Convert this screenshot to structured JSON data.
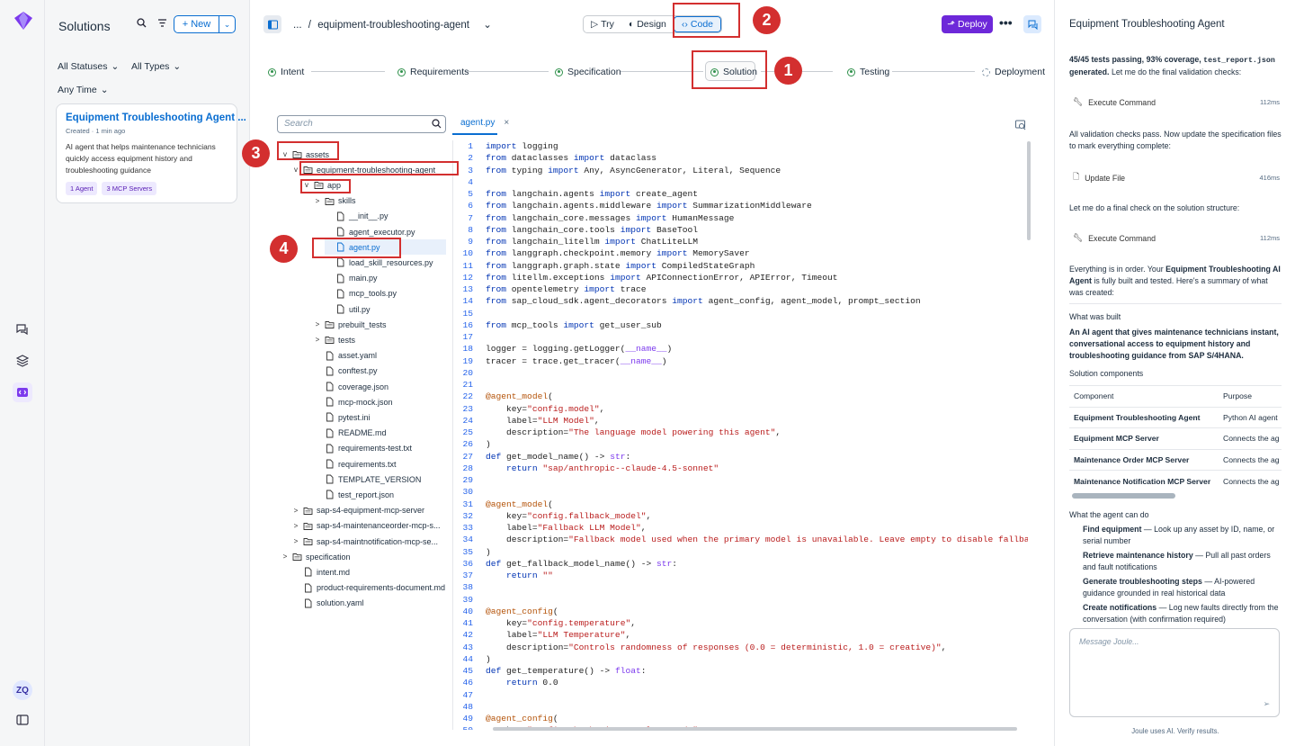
{
  "rail": {
    "user_initials": "ZQ"
  },
  "solutions": {
    "title": "Solutions",
    "new_label": "New",
    "filters": {
      "status": "All Statuses",
      "type": "All Types",
      "time": "Any Time"
    },
    "card": {
      "title": "Equipment Troubleshooting Agent",
      "more": "...",
      "created": "Created · 1 min ago",
      "description": "AI agent that helps maintenance technicians quickly access equipment history and troubleshooting guidance",
      "tags": [
        "1 Agent",
        "3 MCP Servers"
      ]
    }
  },
  "topbar": {
    "breadcrumb_ellipsis": "...",
    "breadcrumb_sep": "/",
    "project": "equipment-troubleshooting-agent",
    "modes": [
      "Try",
      "Design",
      "Code"
    ],
    "deploy_label": "Deploy",
    "more": "•••"
  },
  "steps": [
    "Intent",
    "Requirements",
    "Specification",
    "Solution",
    "Testing",
    "Deployment"
  ],
  "tree": {
    "search_placeholder": "Search",
    "items": [
      {
        "label": "assets",
        "caret": "v",
        "icon": "folder"
      },
      {
        "label": "equipment-troubleshooting-agent",
        "caret": "v",
        "icon": "folder"
      },
      {
        "label": "app",
        "caret": "v",
        "icon": "folder"
      },
      {
        "label": "skills",
        "caret": ">",
        "icon": "folder"
      },
      {
        "label": "__init__.py",
        "caret": "",
        "icon": "file"
      },
      {
        "label": "agent_executor.py",
        "caret": "",
        "icon": "file"
      },
      {
        "label": "agent.py",
        "caret": "",
        "icon": "file",
        "selected": true
      },
      {
        "label": "load_skill_resources.py",
        "caret": "",
        "icon": "file"
      },
      {
        "label": "main.py",
        "caret": "",
        "icon": "file"
      },
      {
        "label": "mcp_tools.py",
        "caret": "",
        "icon": "file"
      },
      {
        "label": "util.py",
        "caret": "",
        "icon": "file"
      },
      {
        "label": "prebuilt_tests",
        "caret": ">",
        "icon": "folder"
      },
      {
        "label": "tests",
        "caret": ">",
        "icon": "folder"
      },
      {
        "label": "asset.yaml",
        "caret": "",
        "icon": "file"
      },
      {
        "label": "conftest.py",
        "caret": "",
        "icon": "file"
      },
      {
        "label": "coverage.json",
        "caret": "",
        "icon": "file"
      },
      {
        "label": "mcp-mock.json",
        "caret": "",
        "icon": "file"
      },
      {
        "label": "pytest.ini",
        "caret": "",
        "icon": "file"
      },
      {
        "label": "README.md",
        "caret": "",
        "icon": "file"
      },
      {
        "label": "requirements-test.txt",
        "caret": "",
        "icon": "file"
      },
      {
        "label": "requirements.txt",
        "caret": "",
        "icon": "file"
      },
      {
        "label": "TEMPLATE_VERSION",
        "caret": "",
        "icon": "file"
      },
      {
        "label": "test_report.json",
        "caret": "",
        "icon": "file"
      },
      {
        "label": "sap-s4-equipment-mcp-server",
        "caret": ">",
        "icon": "folder"
      },
      {
        "label": "sap-s4-maintenanceorder-mcp-s...",
        "caret": ">",
        "icon": "folder"
      },
      {
        "label": "sap-s4-maintnotification-mcp-se...",
        "caret": ">",
        "icon": "folder"
      },
      {
        "label": "specification",
        "caret": ">",
        "icon": "folder"
      },
      {
        "label": "intent.md",
        "caret": "",
        "icon": "file"
      },
      {
        "label": "product-requirements-document.md",
        "caret": "",
        "icon": "file"
      },
      {
        "label": "solution.yaml",
        "caret": "",
        "icon": "file"
      }
    ]
  },
  "editor": {
    "tab": "agent.py",
    "tab_close": "×",
    "lines": [
      "import logging",
      "from dataclasses import dataclass",
      "from typing import Any, AsyncGenerator, Literal, Sequence",
      "",
      "from langchain.agents import create_agent",
      "from langchain.agents.middleware import SummarizationMiddleware",
      "from langchain_core.messages import HumanMessage",
      "from langchain_core.tools import BaseTool",
      "from langchain_litellm import ChatLiteLLM",
      "from langgraph.checkpoint.memory import MemorySaver",
      "from langgraph.graph.state import CompiledStateGraph",
      "from litellm.exceptions import APIConnectionError, APIError, Timeout",
      "from opentelemetry import trace",
      "from sap_cloud_sdk.agent_decorators import agent_config, agent_model, prompt_section",
      "",
      "from mcp_tools import get_user_sub",
      "",
      "logger = logging.getLogger(__name__)",
      "tracer = trace.get_tracer(__name__)",
      "",
      "",
      "@agent_model(",
      "    key=\"config.model\",",
      "    label=\"LLM Model\",",
      "    description=\"The language model powering this agent\",",
      ")",
      "def get_model_name() -> str:",
      "    return \"sap/anthropic--claude-4.5-sonnet\"",
      "",
      "",
      "@agent_model(",
      "    key=\"config.fallback_model\",",
      "    label=\"Fallback LLM Model\",",
      "    description=\"Fallback model used when the primary model is unavailable. Leave empty to disable fallback.\",",
      ")",
      "def get_fallback_model_name() -> str:",
      "    return \"\"",
      "",
      "",
      "@agent_config(",
      "    key=\"config.temperature\",",
      "    label=\"LLM Temperature\",",
      "    description=\"Controls randomness of responses (0.0 = deterministic, 1.0 = creative)\",",
      ")",
      "def get_temperature() -> float:",
      "    return 0.0",
      "",
      "",
      "@agent_config(",
      "    key=\"config.checkpointer_ttl_seconds\","
    ]
  },
  "chat": {
    "title": "Equipment Troubleshooting Agent",
    "msg1_bold_a": "45/45 tests passing, 93% coverage,",
    "msg1_code": "test_report.json",
    "msg1_bold_b": "generated.",
    "msg1_rest": "Let me do the final validation checks:",
    "tool1": "Execute Command",
    "tool1_ms": "112ms",
    "msg2": "All validation checks pass. Now update the specification files to mark everything complete:",
    "tool2": "Update File",
    "tool2_ms": "416ms",
    "msg3": "Let me do a final check on the solution structure:",
    "tool3": "Execute Command",
    "tool3_ms": "112ms",
    "msg4_a": "Everything is in order. Your",
    "msg4_bold": "Equipment Troubleshooting AI Agent",
    "msg4_b": "is fully built and tested. Here's a summary of what was created:",
    "built_heading": "What was built",
    "built_text": "An AI agent that gives maintenance technicians instant, conversational access to equipment history and troubleshooting guidance from SAP S/4HANA.",
    "components_heading": "Solution components",
    "table_headers": [
      "Component",
      "Purpose"
    ],
    "table_rows": [
      [
        "Equipment Troubleshooting Agent",
        "Python AI agent"
      ],
      [
        "Equipment MCP Server",
        "Connects the ag"
      ],
      [
        "Maintenance Order MCP Server",
        "Connects the ag"
      ],
      [
        "Maintenance Notification MCP Server",
        "Connects the ag"
      ]
    ],
    "can_do_heading": "What the agent can do",
    "capabilities": [
      {
        "b": "Find equipment",
        "t": " — Look up any asset by ID, name, or serial number"
      },
      {
        "b": "Retrieve maintenance history",
        "t": " — Pull all past orders and fault notifications"
      },
      {
        "b": "Generate troubleshooting steps",
        "t": " — AI-powered guidance grounded in real historical data"
      },
      {
        "b": "Create notifications",
        "t": " — Log new faults directly from the conversation (with confirmation required)"
      }
    ],
    "input_placeholder": "Message Joule...",
    "footer": "Joule uses AI. Verify results."
  },
  "annotations": [
    "1",
    "2",
    "3",
    "4"
  ],
  "colors": {
    "accent": "#0a6ed1",
    "deploy": "#6d28d9",
    "annotation": "#d32f2f",
    "done": "#30914c"
  }
}
